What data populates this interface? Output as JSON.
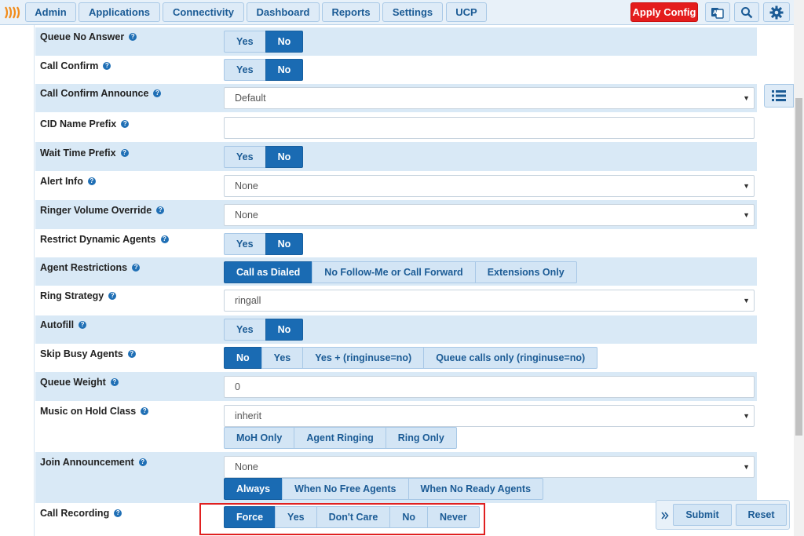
{
  "nav": {
    "items": [
      "Admin",
      "Applications",
      "Connectivity",
      "Dashboard",
      "Reports",
      "Settings",
      "UCP"
    ],
    "apply_label": "Apply Config",
    "icons": [
      "translate-icon",
      "search-icon",
      "gear-icon"
    ]
  },
  "form": {
    "queue_no_answer": {
      "label": "Queue No Answer",
      "options": [
        "Yes",
        "No"
      ],
      "selected": "No"
    },
    "call_confirm": {
      "label": "Call Confirm",
      "options": [
        "Yes",
        "No"
      ],
      "selected": "No"
    },
    "call_confirm_announce": {
      "label": "Call Confirm Announce",
      "value": "Default"
    },
    "cid_name_prefix": {
      "label": "CID Name Prefix",
      "value": ""
    },
    "wait_time_prefix": {
      "label": "Wait Time Prefix",
      "options": [
        "Yes",
        "No"
      ],
      "selected": "No"
    },
    "alert_info": {
      "label": "Alert Info",
      "value": "None"
    },
    "ringer_volume_override": {
      "label": "Ringer Volume Override",
      "value": "None"
    },
    "restrict_dynamic_agents": {
      "label": "Restrict Dynamic Agents",
      "options": [
        "Yes",
        "No"
      ],
      "selected": "No"
    },
    "agent_restrictions": {
      "label": "Agent Restrictions",
      "options": [
        "Call as Dialed",
        "No Follow-Me or Call Forward",
        "Extensions Only"
      ],
      "selected": "Call as Dialed"
    },
    "ring_strategy": {
      "label": "Ring Strategy",
      "value": "ringall"
    },
    "autofill": {
      "label": "Autofill",
      "options": [
        "Yes",
        "No"
      ],
      "selected": "No"
    },
    "skip_busy_agents": {
      "label": "Skip Busy Agents",
      "options": [
        "No",
        "Yes",
        "Yes + (ringinuse=no)",
        "Queue calls only (ringinuse=no)"
      ],
      "selected": "No"
    },
    "queue_weight": {
      "label": "Queue Weight",
      "value": "0"
    },
    "music_on_hold_class": {
      "label": "Music on Hold Class",
      "value": "inherit",
      "options": [
        "MoH Only",
        "Agent Ringing",
        "Ring Only"
      ],
      "selected": ""
    },
    "join_announcement": {
      "label": "Join Announcement",
      "value": "None",
      "options": [
        "Always",
        "When No Free Agents",
        "When No Ready Agents"
      ],
      "selected": "Always"
    },
    "call_recording": {
      "label": "Call Recording",
      "options": [
        "Force",
        "Yes",
        "Don't Care",
        "No",
        "Never"
      ],
      "selected": "Force"
    }
  },
  "actions": {
    "submit": "Submit",
    "reset": "Reset"
  },
  "help_glyph": "?",
  "colors": {
    "accent": "#1a6bb3",
    "apply": "#e41d1d",
    "highlight": "#e02020"
  }
}
